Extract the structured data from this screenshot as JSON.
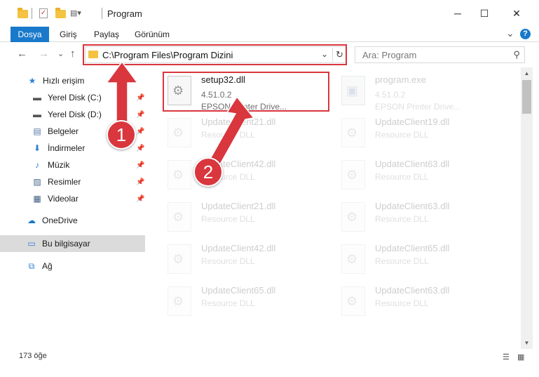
{
  "window": {
    "title": "Program",
    "minimize_glyph": "─",
    "maximize_glyph": "☐",
    "close_glyph": "✕"
  },
  "ribbon": {
    "tabs": [
      "Dosya",
      "Giriş",
      "Paylaş",
      "Görünüm"
    ],
    "collapse_glyph": "⌄",
    "help_glyph": "?"
  },
  "nav": {
    "back_glyph": "←",
    "forward_glyph": "→",
    "recent_glyph": "⌄",
    "up_glyph": "↑",
    "address_path": "C:\\Program Files\\Program Dizini",
    "address_dropdown_glyph": "⌄",
    "refresh_glyph": "↻",
    "search_placeholder": "Ara: Program",
    "search_glyph": "⚲"
  },
  "sidebar": {
    "items": [
      {
        "label": "Hızlı erişim",
        "icon": "star-icon",
        "glyph": "★",
        "color": "#2d7fd3",
        "pinned": false
      },
      {
        "label": "Yerel Disk (C:)",
        "icon": "drive-icon",
        "glyph": "▬",
        "color": "#555555",
        "pinned": true
      },
      {
        "label": "Yerel Disk (D:)",
        "icon": "drive-icon",
        "glyph": "▬",
        "color": "#555555",
        "pinned": true
      },
      {
        "label": "Belgeler",
        "icon": "documents-icon",
        "glyph": "▤",
        "color": "#5577aa",
        "pinned": true
      },
      {
        "label": "İndirmeler",
        "icon": "download-icon",
        "glyph": "⬇",
        "color": "#2d7fd3",
        "pinned": true
      },
      {
        "label": "Müzik",
        "icon": "music-icon",
        "glyph": "♪",
        "color": "#2d7fd3",
        "pinned": true
      },
      {
        "label": "Resimler",
        "icon": "pictures-icon",
        "glyph": "▨",
        "color": "#4a6a8a",
        "pinned": true
      },
      {
        "label": "Videolar",
        "icon": "videos-icon",
        "glyph": "▦",
        "color": "#3a5a7a",
        "pinned": true
      },
      {
        "label": "OneDrive",
        "icon": "cloud-icon",
        "glyph": "☁",
        "color": "#1979ca",
        "pinned": false
      },
      {
        "label": "Bu bilgisayar",
        "icon": "computer-icon",
        "glyph": "▭",
        "color": "#2d7fd3",
        "pinned": false
      },
      {
        "label": "Ağ",
        "icon": "network-icon",
        "glyph": "⧉",
        "color": "#2d7fd3",
        "pinned": false
      }
    ],
    "pin_glyph": "📌"
  },
  "files": [
    {
      "name": "setup32.dll",
      "version": "4.51.0.2",
      "description": "EPSON Printer Drive...",
      "faded": false,
      "exe": false
    },
    {
      "name": "program.exe",
      "version": "4.51.0.2",
      "description": "EPSON Printer Drive...",
      "faded": true,
      "exe": true
    },
    {
      "name": "UpdateClient21.dll",
      "version": "",
      "description": "Resource DLL",
      "faded": true,
      "exe": false
    },
    {
      "name": "UpdateClient19.dll",
      "version": "",
      "description": "Resource DLL",
      "faded": true,
      "exe": false
    },
    {
      "name": "UpdateClient42.dll",
      "version": "",
      "description": "Resource DLL",
      "faded": true,
      "exe": false
    },
    {
      "name": "UpdateClient63.dll",
      "version": "",
      "description": "Resource DLL",
      "faded": true,
      "exe": false
    },
    {
      "name": "UpdateClient21.dll",
      "version": "",
      "description": "Resource DLL",
      "faded": true,
      "exe": false
    },
    {
      "name": "UpdateClient63.dll",
      "version": "",
      "description": "Resource DLL",
      "faded": true,
      "exe": false
    },
    {
      "name": "UpdateClient42.dll",
      "version": "",
      "description": "Resource DLL",
      "faded": true,
      "exe": false
    },
    {
      "name": "UpdateClient65.dll",
      "version": "",
      "description": "Resource DLL",
      "faded": true,
      "exe": false
    },
    {
      "name": "UpdateClient65.dll",
      "version": "",
      "description": "Resource DLL",
      "faded": true,
      "exe": false
    },
    {
      "name": "UpdateClient63.dll",
      "version": "",
      "description": "Resource DLL",
      "faded": true,
      "exe": false
    }
  ],
  "status": {
    "item_count": "173 öğe",
    "details_view_glyph": "☰",
    "icons_view_glyph": "▦"
  },
  "callouts": {
    "step1": "1",
    "step2": "2",
    "color": "#d9363e"
  }
}
